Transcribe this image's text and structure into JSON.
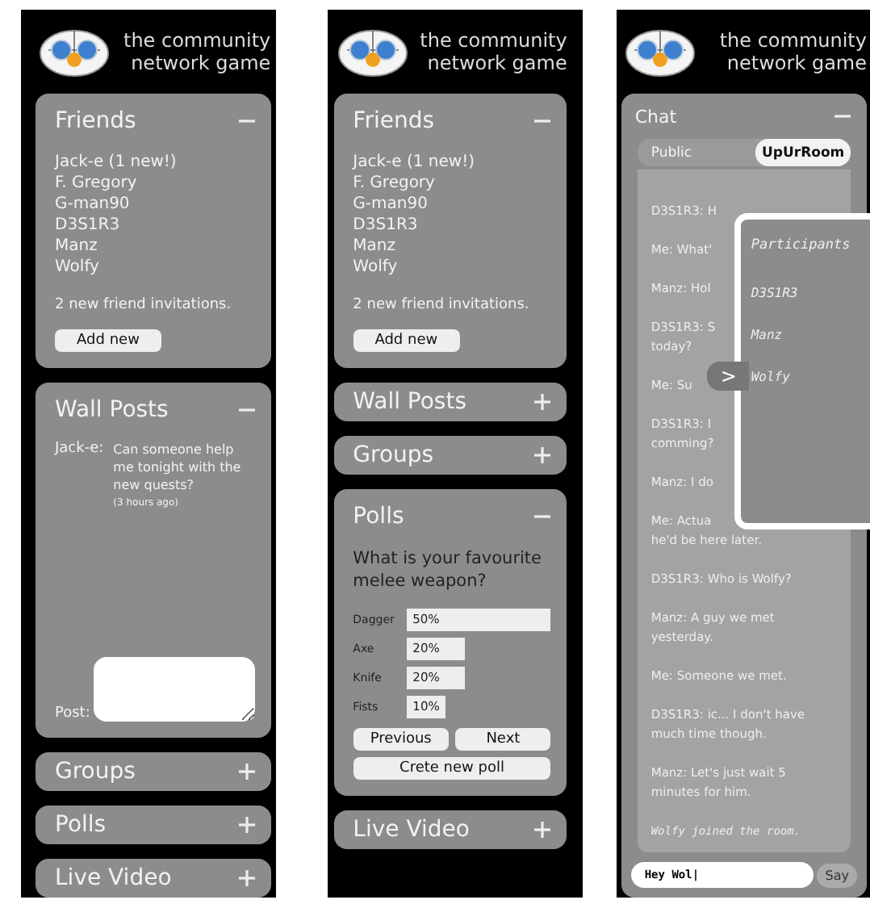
{
  "screens": [
    {
      "header": {
        "title": "the community network game"
      },
      "panels": [
        {
          "kind": "friends",
          "title": "Friends",
          "expanded": true,
          "friends": [
            "Jack-e (1 new!)",
            "F. Gregory",
            "G-man90",
            "D3S1R3",
            "Manz",
            "Wolfy"
          ],
          "note": "2 new friend invitations.",
          "button": "Add new"
        },
        {
          "kind": "wall",
          "title": "Wall Posts",
          "expanded": true,
          "posts": [
            {
              "author": "Jack-e:",
              "text": "Can someone help me tonight with the new quests?",
              "time": "(3 hours ago)"
            }
          ],
          "post_label": "Post:"
        },
        {
          "kind": "section",
          "title": "Groups",
          "expanded": false
        },
        {
          "kind": "section",
          "title": "Polls",
          "expanded": false
        },
        {
          "kind": "section",
          "title": "Live Video",
          "expanded": false
        }
      ]
    },
    {
      "header": {
        "title": "the community network game"
      },
      "panels": [
        {
          "kind": "friends",
          "title": "Friends",
          "expanded": true,
          "friends": [
            "Jack-e (1 new!)",
            "F. Gregory",
            "G-man90",
            "D3S1R3",
            "Manz",
            "Wolfy"
          ],
          "note": "2 new friend invitations.",
          "button": "Add new"
        },
        {
          "kind": "section",
          "title": "Wall Posts",
          "expanded": false
        },
        {
          "kind": "section",
          "title": "Groups",
          "expanded": false
        },
        {
          "kind": "poll",
          "title": "Polls",
          "expanded": true,
          "question": "What is your favourite melee weapon?",
          "options": [
            {
              "label": "Dagger",
              "reading": "50%"
            },
            {
              "label": "Axe",
              "reading": "20%"
            },
            {
              "label": "Knife",
              "reading": "20%"
            },
            {
              "label": "Fists",
              "reading": "10%"
            }
          ],
          "buttons": [
            "Previous",
            "Next"
          ],
          "create_button": "Crete new poll"
        },
        {
          "kind": "section",
          "title": "Live Video",
          "expanded": false
        }
      ]
    },
    {
      "header": {
        "title": "the community network game"
      },
      "panels": [
        {
          "kind": "chat",
          "title": "Chat",
          "expanded": true,
          "tabs": [
            {
              "label": "Public",
              "selected": false
            },
            {
              "label": "UpUrRoom",
              "selected": true
            }
          ],
          "messages": [
            {
              "kind": "message",
              "text": "D3S1R3: H"
            },
            {
              "kind": "message",
              "text": "Me: What'"
            },
            {
              "kind": "message",
              "text": "Manz: Hol"
            },
            {
              "kind": "message",
              "text": "D3S1R3: S\ntoday?"
            },
            {
              "kind": "message",
              "text": "Me: Su"
            },
            {
              "kind": "message",
              "text": "D3S1R3: I\ncomming?"
            },
            {
              "kind": "message",
              "text": "Manz: I do"
            },
            {
              "kind": "message",
              "text": "Me: Actua\nhe'd be here later."
            },
            {
              "kind": "message",
              "text": "D3S1R3: Who is Wolfy?"
            },
            {
              "kind": "message",
              "text": "Manz: A guy we met yesterday."
            },
            {
              "kind": "message",
              "text": "Me: Someone we met."
            },
            {
              "kind": "message",
              "text": "D3S1R3: ic... I don't have much time though."
            },
            {
              "kind": "message",
              "text": "Manz: Let's just wait 5 minutes for him."
            },
            {
              "kind": "event",
              "text": "Wolfy joined the room."
            }
          ],
          "participants": {
            "toggle": ">",
            "title": "Participants",
            "names": [
              "D3S1R3",
              "Manz",
              "Wolfy"
            ]
          },
          "input": {
            "value": "Hey Wol|"
          },
          "send": "Say"
        }
      ]
    }
  ]
}
